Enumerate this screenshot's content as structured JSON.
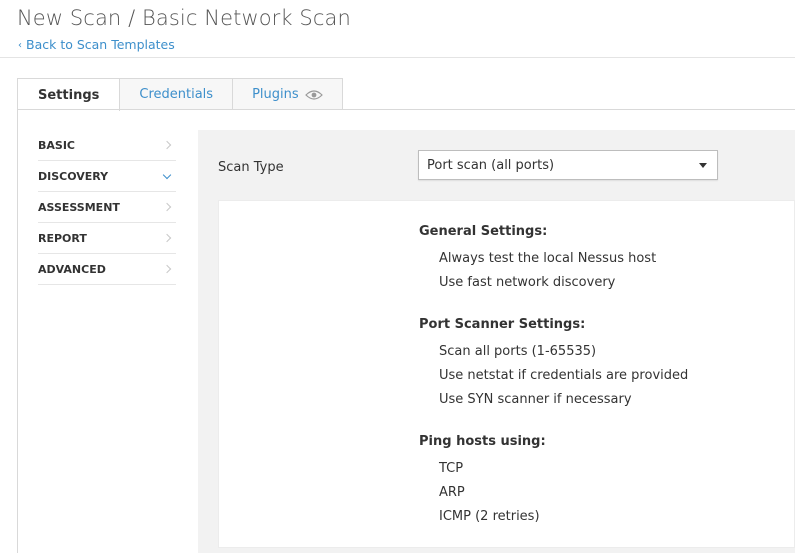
{
  "header": {
    "title": "New Scan / Basic Network Scan",
    "back_link": "Back to Scan Templates"
  },
  "tabs": [
    {
      "label": "Settings",
      "active": true
    },
    {
      "label": "Credentials",
      "active": false
    },
    {
      "label": "Plugins",
      "active": false,
      "icon": "eye-icon"
    }
  ],
  "sidebar": {
    "items": [
      {
        "label": "BASIC",
        "state": "collapsed"
      },
      {
        "label": "DISCOVERY",
        "state": "expanded"
      },
      {
        "label": "ASSESSMENT",
        "state": "collapsed"
      },
      {
        "label": "REPORT",
        "state": "collapsed"
      },
      {
        "label": "ADVANCED",
        "state": "collapsed"
      }
    ]
  },
  "main": {
    "scan_type_label": "Scan Type",
    "scan_type_value": "Port scan (all ports)",
    "summary": {
      "general_title": "General Settings:",
      "general_lines": [
        "Always test the local Nessus host",
        "Use fast network discovery"
      ],
      "port_title": "Port Scanner Settings:",
      "port_lines": [
        "Scan all ports (1-65535)",
        "Use netstat if credentials are provided",
        "Use SYN scanner if necessary"
      ],
      "ping_title": "Ping hosts using:",
      "ping_lines": [
        "TCP",
        "ARP",
        "ICMP (2 retries)"
      ]
    }
  },
  "colors": {
    "link": "#3d8fcb",
    "panel_bg": "#f2f2f2",
    "border": "#d9d9d9"
  }
}
